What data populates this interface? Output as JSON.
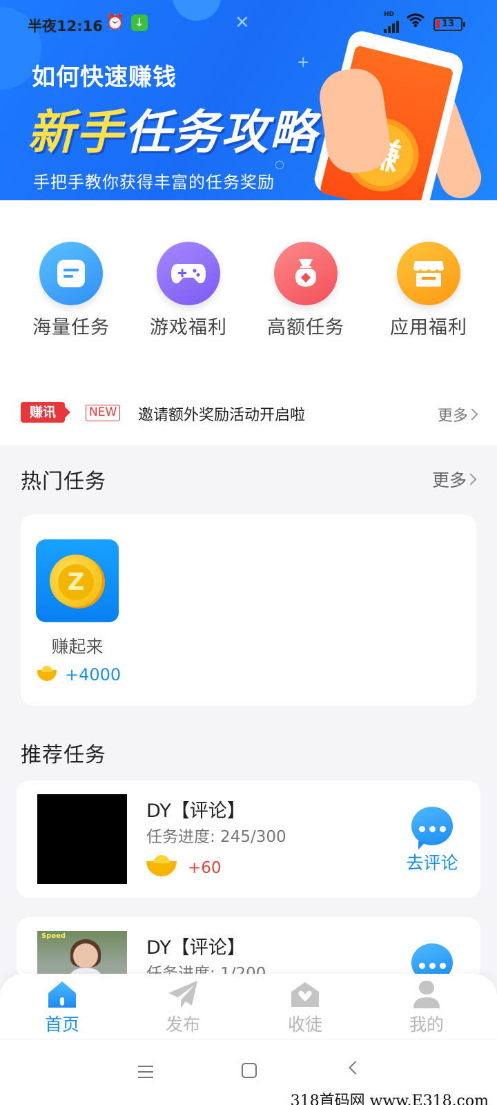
{
  "status_bar": {
    "time": "半夜12:16",
    "battery": "13",
    "network": "HD"
  },
  "banner": {
    "subtitle": "如何快速赚钱",
    "title_highlight": "新手",
    "title_rest": "任务攻略",
    "description": "手把手教你获得丰富的任务奖励",
    "phone_glyph": "赚"
  },
  "quick_entries": [
    {
      "label": "海量任务",
      "icon": "document-icon",
      "color": "#2f8ff7"
    },
    {
      "label": "游戏福利",
      "icon": "gamepad-icon",
      "color": "#7b5af0"
    },
    {
      "label": "高额任务",
      "icon": "money-bag-icon",
      "color": "#f24e58"
    },
    {
      "label": "应用福利",
      "icon": "store-icon",
      "color": "#ff9a12"
    }
  ],
  "ticker": {
    "badge": "赚讯",
    "new_tag": "NEW",
    "text": "邀请额外奖励活动开启啦",
    "more": "更多"
  },
  "hot_tasks": {
    "title": "热门任务",
    "more": "更多",
    "items": [
      {
        "name": "赚起来",
        "reward": "+4000",
        "icon_letter": "Z"
      }
    ]
  },
  "recommended": {
    "title": "推荐任务",
    "items": [
      {
        "title": "DY【评论】",
        "progress": "任务进度: 245/300",
        "reward": "+60",
        "action": "去评论"
      },
      {
        "title": "DY【评论】",
        "progress": "任务进度: 1/200",
        "reward": "",
        "action": "",
        "thumb_tag": "Speed"
      }
    ]
  },
  "tabbar": [
    {
      "label": "首页",
      "icon": "home-icon",
      "active": true
    },
    {
      "label": "发布",
      "icon": "paper-plane-icon",
      "active": false
    },
    {
      "label": "收徒",
      "icon": "mail-heart-icon",
      "active": false
    },
    {
      "label": "我的",
      "icon": "user-icon",
      "active": false
    }
  ],
  "watermark": "318首码网 www.E318.com",
  "colors": {
    "accent": "#1a8fe6",
    "banner": "#1a6cf6",
    "reward_red": "#e0483c"
  }
}
